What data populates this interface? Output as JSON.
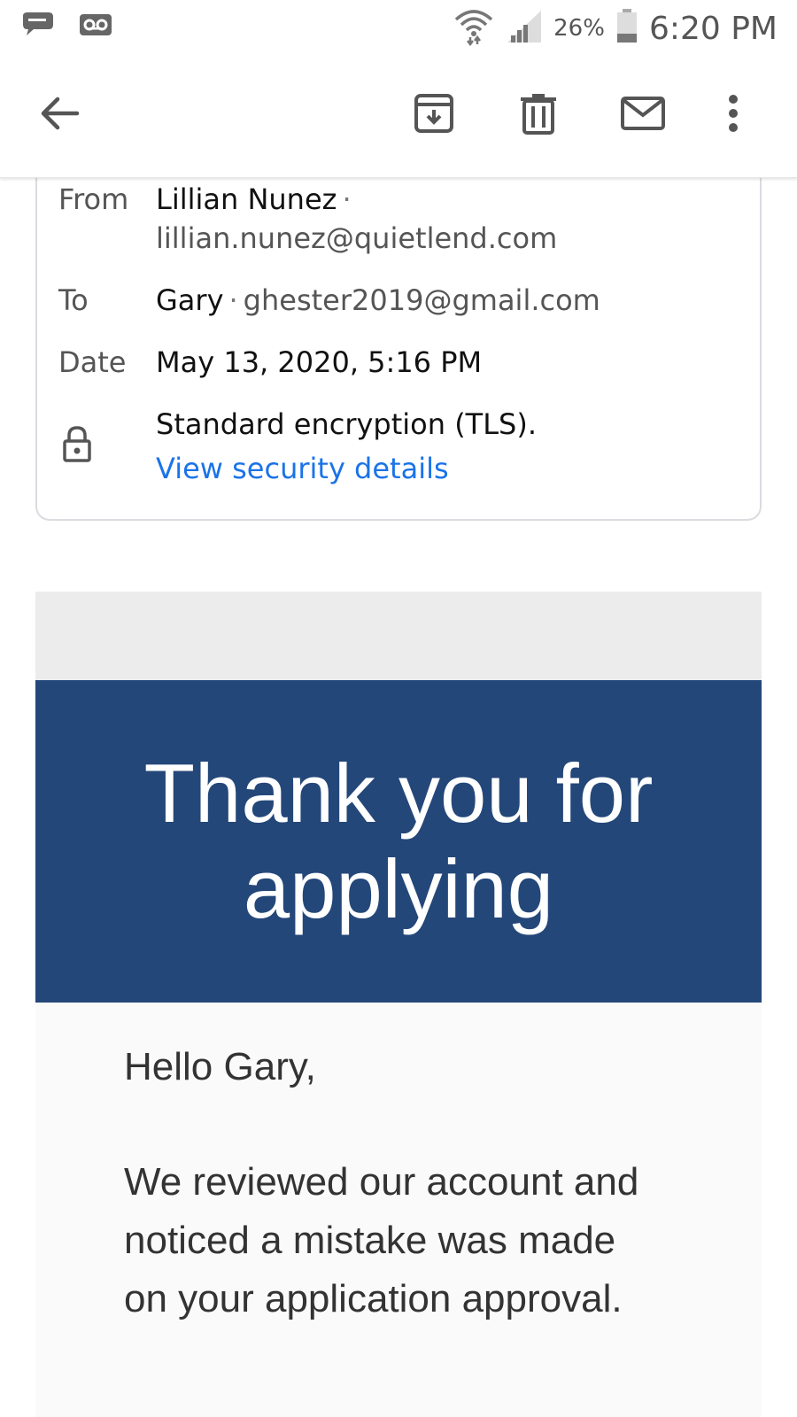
{
  "status_bar": {
    "battery_percent": "26%",
    "time": "6:20 PM",
    "icons": [
      "messages-icon",
      "voicemail-icon",
      "wifi-icon",
      "signal-icon",
      "battery-icon"
    ]
  },
  "toolbar": {
    "icons": [
      "back-arrow-icon",
      "archive-icon",
      "delete-icon",
      "mark-unread-icon",
      "more-options-icon"
    ]
  },
  "header": {
    "from_label": "From",
    "from_name": "Lillian Nunez",
    "from_email": "lillian.nunez@quietlend.com",
    "to_label": "To",
    "to_name": "Gary",
    "to_email": "ghester2019@gmail.com",
    "date_label": "Date",
    "date_value": "May 13, 2020, 5:16 PM",
    "encryption_text": "Standard encryption (TLS).",
    "security_link": "View security details"
  },
  "email_body": {
    "banner_title": "Thank you for applying",
    "greeting": "Hello Gary,",
    "paragraph": "We reviewed our account and noticed a mistake was made on your application approval."
  },
  "colors": {
    "banner_bg": "#244779",
    "link": "#1a73e8",
    "band": "#ececec"
  }
}
